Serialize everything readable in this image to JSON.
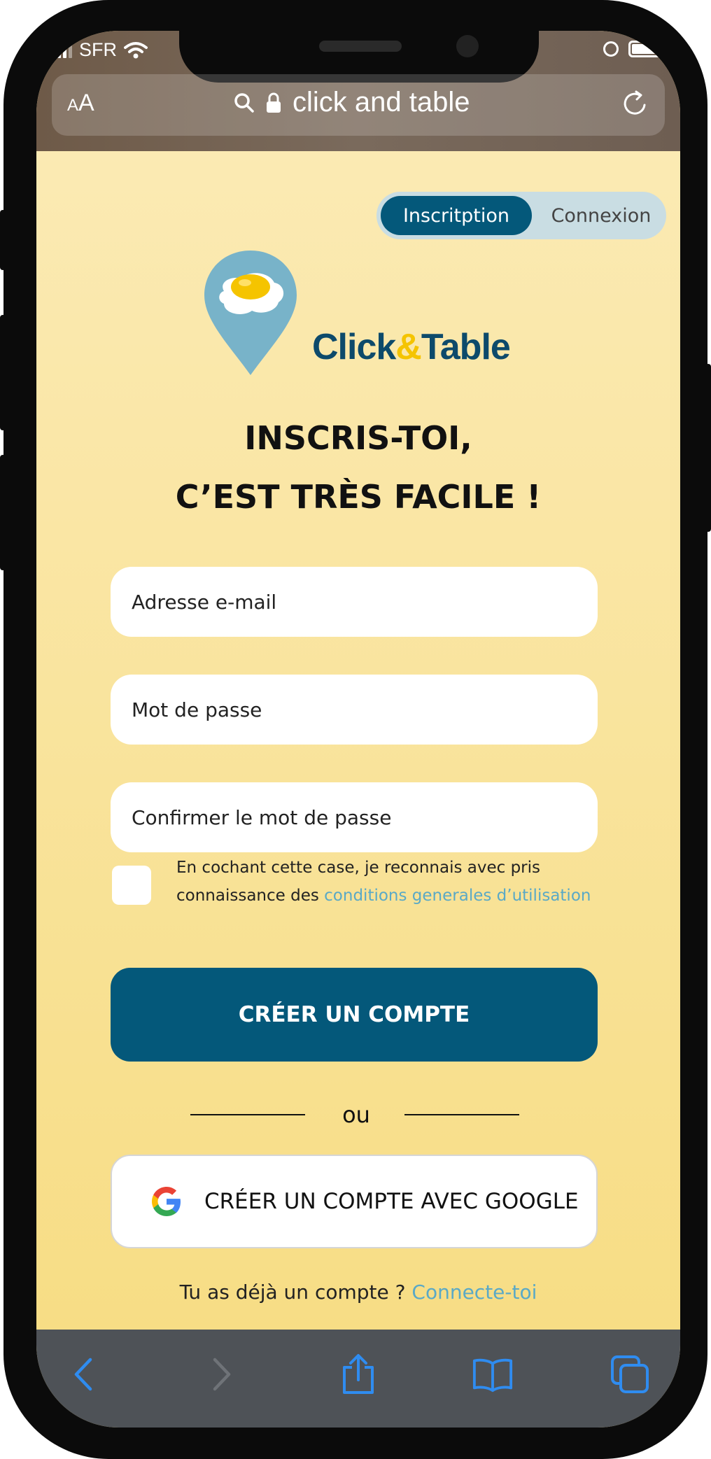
{
  "status_bar": {
    "carrier": "SFR"
  },
  "browser": {
    "aa_small": "A",
    "aa_big": "A",
    "url": "click and table"
  },
  "toggle": {
    "signup_label": "Inscritption",
    "login_label": "Connexion"
  },
  "brand": {
    "name_part1": "Click",
    "name_amp": "&",
    "name_part2": "Table"
  },
  "headline": {
    "line1": "INSCRIS-TOI,",
    "line2": "C’EST TRÈS FACILE !"
  },
  "form": {
    "email_placeholder": "Adresse e-mail",
    "password_placeholder": "Mot de passe",
    "confirm_placeholder": "Confirmer le mot de passe",
    "consent_text": "En cochant cette case, je reconnais avec pris connaissance des",
    "consent_link": "conditions generales d’utilisation",
    "create_button": "CRÉER UN COMPTE",
    "or_text": "ou",
    "google_button": "CRÉER UN COMPTE AVEC GOOGLE",
    "existing_account_text": "Tu as déjà un compte ?",
    "login_link": "Connecte-toi"
  },
  "colors": {
    "primary": "#04587a",
    "link": "#5aa9c6",
    "background": "#f8e19a",
    "accent_yellow": "#f5c400"
  },
  "icons": [
    "signal-icon",
    "wifi-icon",
    "alarm-icon",
    "battery-icon",
    "search-icon",
    "lock-icon",
    "reload-icon",
    "location-pin-logo",
    "google-icon",
    "back-icon",
    "forward-icon",
    "share-icon",
    "bookmarks-icon",
    "tabs-icon"
  ]
}
